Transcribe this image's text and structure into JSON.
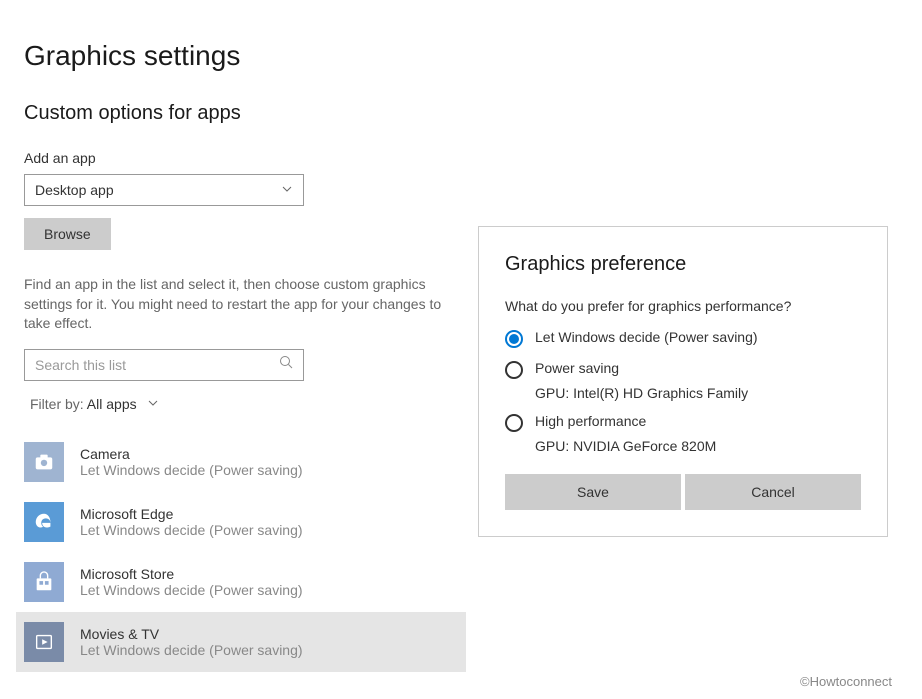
{
  "page_title": "Graphics settings",
  "section_title": "Custom options for apps",
  "add_app_label": "Add an app",
  "app_type_dropdown": {
    "value": "Desktop app"
  },
  "browse_label": "Browse",
  "description": "Find an app in the list and select it, then choose custom graphics settings for it. You might need to restart the app for your changes to take effect.",
  "search_placeholder": "Search this list",
  "filter_label": "Filter by: ",
  "filter_value": "All apps",
  "apps": [
    {
      "name": "Camera",
      "sub": "Let Windows decide (Power saving)",
      "icon": "camera",
      "selected": false
    },
    {
      "name": "Microsoft Edge",
      "sub": "Let Windows decide (Power saving)",
      "icon": "edge",
      "selected": false
    },
    {
      "name": "Microsoft Store",
      "sub": "Let Windows decide (Power saving)",
      "icon": "store",
      "selected": false
    },
    {
      "name": "Movies & TV",
      "sub": "Let Windows decide (Power saving)",
      "icon": "movies",
      "selected": true
    }
  ],
  "dialog": {
    "title": "Graphics preference",
    "question": "What do you prefer for graphics performance?",
    "options": [
      {
        "label": "Let Windows decide (Power saving)",
        "checked": true,
        "gpu": ""
      },
      {
        "label": "Power saving",
        "checked": false,
        "gpu": "GPU: Intel(R) HD Graphics Family"
      },
      {
        "label": "High performance",
        "checked": false,
        "gpu": "GPU: NVIDIA GeForce 820M"
      }
    ],
    "save_label": "Save",
    "cancel_label": "Cancel"
  },
  "watermark": "©Howtoconnect"
}
